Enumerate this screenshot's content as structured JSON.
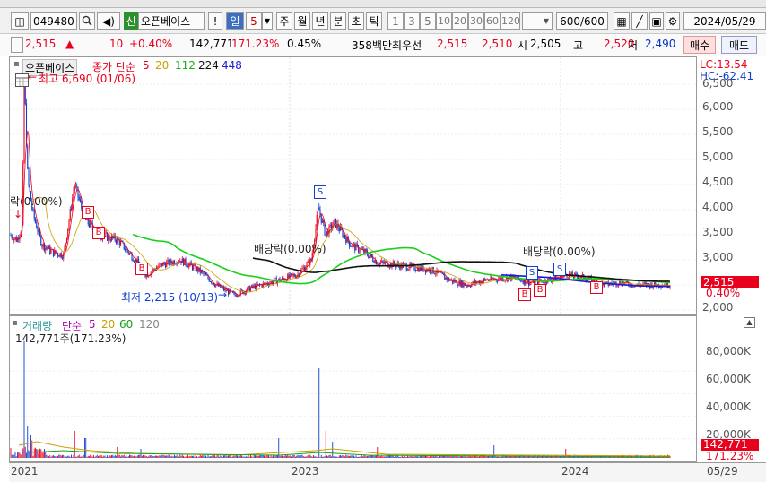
{
  "toolbar": {
    "stock_code": "049480",
    "market_badge": "신",
    "stock_name": "오픈베이스",
    "period_selected": "일",
    "period_value": "5",
    "periods": [
      "주",
      "월",
      "년",
      "분",
      "초",
      "틱"
    ],
    "minutes": [
      "1",
      "3",
      "5",
      "10",
      "20",
      "30",
      "60",
      "120"
    ],
    "count_display": "600/600",
    "date": "2024/05/29",
    "exclaim": "!"
  },
  "quote": {
    "price": "2,515",
    "change_arrow": "▲",
    "change": "10",
    "change_rate": "+0.40%",
    "volume": "142,771",
    "volume_ratio": "171.23%",
    "turnover_rate": "0.45%",
    "amount": "358백만",
    "best_bid_label": "최우선",
    "ask": "2,515",
    "bid": "2,510",
    "open_label": "시",
    "open": "2,505",
    "high_label": "고",
    "high": "2,520",
    "low_label": "저",
    "low": "2,490",
    "buy_label": "매수",
    "sell_label": "매도"
  },
  "price_pane": {
    "legend_name": "오픈베이스",
    "legend_ma_label": "종가 단순",
    "legend_periods": [
      "5",
      "20",
      "112",
      "224",
      "448"
    ],
    "lc_label": "LC:13.54",
    "hc_label": "HC:-62.41",
    "current_price_tag": "2,515",
    "current_change_tag": "0.40%",
    "y_ticks": [
      "6,500",
      "6,000",
      "5,500",
      "5,000",
      "4,500",
      "4,000",
      "3,500",
      "3,000",
      "2,500",
      "2,000"
    ],
    "annotations": {
      "high": "최고 6,690 (01/06)",
      "low": "최저 2,215 (10/13)",
      "dividend1": "배당락(0.00%)",
      "dividend2": "배당락(0.00%)",
      "left_cut": "락(0.00%)"
    },
    "colors": {
      "candle_up": "#e8001c",
      "candle_down": "#1040d0",
      "ma5": "#e8001c",
      "ma20": "#c8a000",
      "ma112": "#19d019",
      "ma224": "#111111",
      "ma448": "#1919e0"
    }
  },
  "volume_pane": {
    "legend_name": "거래량",
    "legend_ma_label": "단순",
    "legend_periods": [
      "5",
      "20",
      "60",
      "120"
    ],
    "sub_label": "142,771주(171.23%)",
    "y_ticks": [
      "80,000K",
      "60,000K",
      "40,000K",
      "20,000K"
    ],
    "current_volume_tag": "142,771",
    "current_ratio_tag": "171.23%"
  },
  "x_axis": {
    "labels": [
      "2021",
      "2023",
      "2024"
    ],
    "last_date": "05/29"
  }
}
